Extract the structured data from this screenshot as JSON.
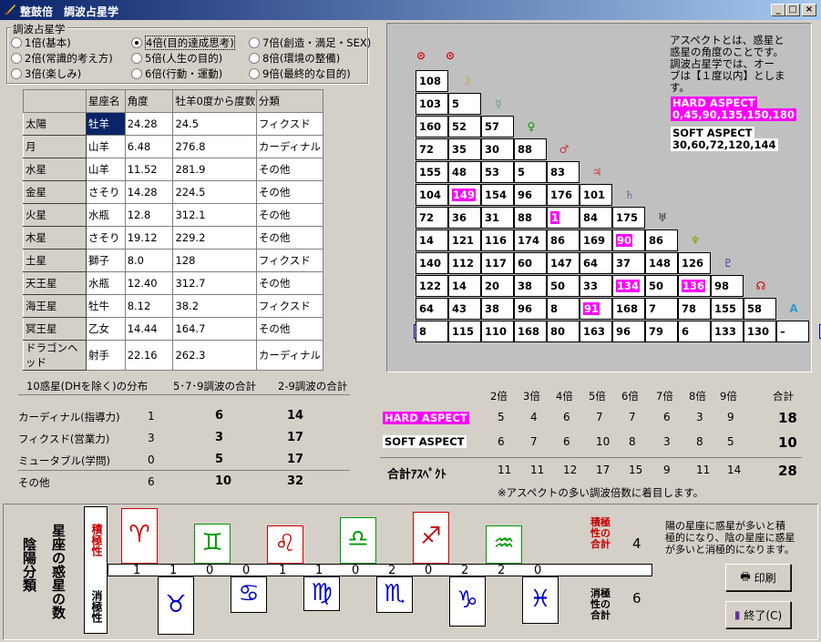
{
  "window": {
    "title": "整鼓倍　調波占星学",
    "min": "_",
    "max": "□",
    "close": "×"
  },
  "options": {
    "group_label": "調波占星学",
    "items": [
      "1倍(基本)",
      "2倍(常識的考え方)",
      "3倍(楽しみ)",
      "4倍(目的達成思考)",
      "5倍(人生の目的)",
      "6倍(行動・運動)",
      "7倍(創造・満足・SEX)",
      "8倍(環境の整備)",
      "9倍(最終的な目的)"
    ],
    "selected": "4倍(目的達成思考)"
  },
  "planet_table": {
    "headers": [
      "",
      "星座名",
      "角度",
      "牡羊0度から度数",
      "分類"
    ],
    "rows": [
      [
        "太陽",
        "牡羊",
        "24.28",
        "24.5",
        "フィクスド"
      ],
      [
        "月",
        "山羊",
        "6.48",
        "276.8",
        "カーディナル"
      ],
      [
        "水星",
        "山羊",
        "11.52",
        "281.9",
        "その他"
      ],
      [
        "金星",
        "さそり",
        "14.28",
        "224.5",
        "その他"
      ],
      [
        "火星",
        "水瓶",
        "12.8",
        "312.1",
        "その他"
      ],
      [
        "木星",
        "さそり",
        "19.12",
        "229.2",
        "その他"
      ],
      [
        "土星",
        "獅子",
        "8.0",
        "128",
        "フィクスド"
      ],
      [
        "天王星",
        "水瓶",
        "12.40",
        "312.7",
        "その他"
      ],
      [
        "海王星",
        "牡牛",
        "8.12",
        "38.2",
        "フィクスド"
      ],
      [
        "冥王星",
        "乙女",
        "14.44",
        "164.7",
        "その他"
      ],
      [
        "ドラゴンヘッド",
        "射手",
        "22.16",
        "262.3",
        "カーディナル"
      ]
    ]
  },
  "aspect_grid": {
    "glyphs": [
      "⊙",
      "☽",
      "☿",
      "♀",
      "♂",
      "♃",
      "♄",
      "♅",
      "♆",
      "♇",
      "☊",
      "A",
      "M"
    ],
    "glyph_colors": [
      "#cc0000",
      "#cc9900",
      "#669999",
      "#009900",
      "#cc3333",
      "#cc3333",
      "#666699",
      "#333333",
      "#999900",
      "#333399",
      "#cc0000",
      "#3399cc",
      "#0000cc"
    ],
    "rows": [
      [
        "108"
      ],
      [
        "103",
        "5"
      ],
      [
        "160",
        "52",
        "57"
      ],
      [
        "72",
        "35",
        "30",
        "88"
      ],
      [
        "155",
        "48",
        "53",
        "5",
        "83"
      ],
      [
        "104",
        "149",
        "154",
        "96",
        "176",
        "101"
      ],
      [
        "72",
        "36",
        "31",
        "88",
        "1",
        "84",
        "175"
      ],
      [
        "14",
        "121",
        "116",
        "174",
        "86",
        "169",
        "90",
        "86"
      ],
      [
        "140",
        "112",
        "117",
        "60",
        "147",
        "64",
        "37",
        "148",
        "126"
      ],
      [
        "122",
        "14",
        "20",
        "38",
        "50",
        "33",
        "134",
        "50",
        "136",
        "98"
      ],
      [
        "64",
        "43",
        "38",
        "96",
        "8",
        "91",
        "168",
        "7",
        "78",
        "155",
        "58"
      ],
      [
        "8",
        "115",
        "110",
        "168",
        "80",
        "163",
        "96",
        "79",
        "6",
        "133",
        "130",
        "–"
      ]
    ],
    "pink": [
      "5-1",
      "6-4",
      "7-6",
      "9-6",
      "9-8",
      "10-5"
    ],
    "note": [
      "アスペクトとは、惑星と",
      "惑星の角度のことです。",
      "調波占星学では、オー",
      "ブは【１度以内】としま",
      "す。"
    ],
    "hard_label": "HARD ASPECT",
    "hard_values": "0,45,90,135,150,180",
    "soft_label": "SOFT ASPECT",
    "soft_values": "30,60,72,120,144"
  },
  "distribution": {
    "headers": [
      "10惑星(DHを除く)の分布",
      "5･7･9調波の合計",
      "2-9調波の合計"
    ],
    "rows": [
      {
        "label": "カーディナル(指導力)",
        "a": "1",
        "b": "6",
        "c": "14"
      },
      {
        "label": "フィクスド(営業力)",
        "a": "3",
        "b": "3",
        "c": "17"
      },
      {
        "label": "ミュータブル(学問)",
        "a": "0",
        "b": "5",
        "c": "17"
      },
      {
        "label": "その他",
        "a": "6",
        "b": "10",
        "c": "32"
      }
    ]
  },
  "harmonics": {
    "headers": [
      "2倍",
      "3倍",
      "4倍",
      "5倍",
      "6倍",
      "7倍",
      "8倍",
      "9倍",
      "合計"
    ],
    "hard_label": "HARD ASPECT",
    "hard": [
      "5",
      "4",
      "6",
      "7",
      "7",
      "6",
      "3",
      "9",
      "18"
    ],
    "soft_label": "SOFT ASPECT",
    "soft": [
      "6",
      "7",
      "6",
      "10",
      "8",
      "3",
      "8",
      "5",
      "10"
    ],
    "total_label": "合計ｱｽﾍﾟｸﾄ",
    "total": [
      "11",
      "11",
      "12",
      "17",
      "15",
      "9",
      "11",
      "14",
      "28"
    ],
    "footnote": "※アスペクトの多い調波倍数に着目します。"
  },
  "yinyang": {
    "title": "陰陽分類",
    "subtitle": "星座の惑星の数",
    "positive": "積極性",
    "negative": "消極性",
    "counts": [
      "1",
      "1",
      "0",
      "0",
      "1",
      "1",
      "0",
      "2",
      "0",
      "2",
      "2",
      "0"
    ],
    "signs_top": [
      "♈",
      "♊",
      "♌",
      "♎",
      "♐",
      "♒"
    ],
    "signs_bottom": [
      "♉",
      "♋",
      "♍",
      "♏",
      "♑",
      "♓"
    ],
    "pos_total_label": "積極性の合計",
    "pos_total": "4",
    "neg_total_label": "消極性の合計",
    "neg_total": "6",
    "description": [
      "陽の星座に惑星が多いと積",
      "極的になり、陰の星座に惑星",
      "が多いと消極的になります。"
    ]
  },
  "buttons": {
    "print": "印刷",
    "exit": "終了(C)"
  }
}
